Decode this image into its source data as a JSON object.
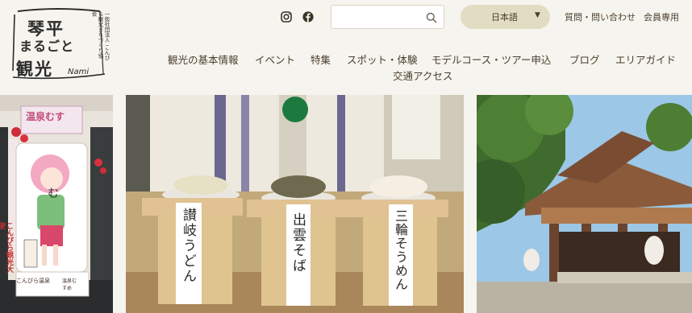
{
  "logo": {
    "line1": "琴平",
    "line2": "まるごと",
    "line3": "観光",
    "nami": "Nami",
    "sub": "一般社団法人 こんぴら観光まちづくり協会"
  },
  "header": {
    "icons": [
      "instagram-icon",
      "facebook-icon",
      "search-icon",
      "caret-down-icon"
    ],
    "search_placeholder": "",
    "language": "日本語",
    "contact": "質問・問い合わせ",
    "members": "会員専用"
  },
  "nav": [
    "観光の基本情報",
    "イベント",
    "特集",
    "スポット・体験",
    "モデルコース・ツアー申込",
    "ブログ",
    "エリアガイド",
    "交通アクセス"
  ],
  "photos": {
    "p2_labels": [
      "讃岐うどん",
      "出雲そば",
      "三輪そうめん"
    ],
    "p1_sign": "温泉むす",
    "p1_tag": "こんぴら観光大使",
    "p1_sign2": "こんぴら温泉",
    "p1_mark": "温泉むすめ",
    "p1_head": "む"
  },
  "colors": {
    "background": "#f6f4ee",
    "text": "#4a4030",
    "language_pill": "#e2dcc2",
    "search_border": "#d9d3c4"
  }
}
